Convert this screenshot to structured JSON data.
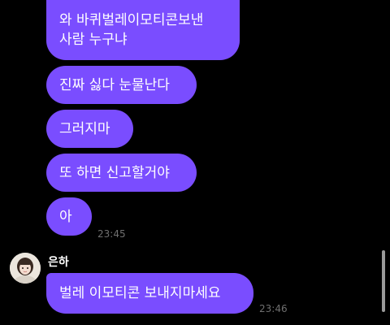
{
  "messages": [
    {
      "lines": [
        "와 바퀴벌레이모티콘보낸",
        "사람 누구냐"
      ]
    },
    {
      "text": "진짜 싫다 눈물난다"
    },
    {
      "text": "그러지마"
    },
    {
      "text": "또 하면 신고할거야"
    },
    {
      "text": "아",
      "time": "23:45"
    }
  ],
  "incoming": {
    "sender": "은하",
    "avatar_icon": "profile-photo-icon",
    "text": "벌레 이모티콘 보내지마세요",
    "time": "23:46"
  },
  "colors": {
    "bubble": "#7a4dff",
    "background": "#000000",
    "timestamp": "#6f6f6f"
  }
}
